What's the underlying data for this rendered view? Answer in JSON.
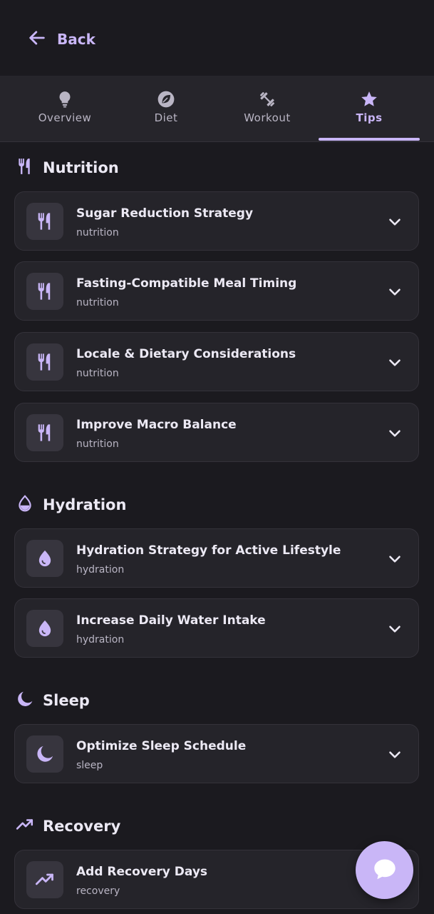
{
  "header": {
    "back_label": "Back",
    "back_icon": "arrow-left-icon"
  },
  "tabs": [
    {
      "label": "Overview",
      "icon": "lightbulb-icon",
      "active": false
    },
    {
      "label": "Diet",
      "icon": "leaf-icon",
      "active": false
    },
    {
      "label": "Workout",
      "icon": "dumbbell-icon",
      "active": false
    },
    {
      "label": "Tips",
      "icon": "star-icon",
      "active": true
    }
  ],
  "sections": {
    "nutrition": {
      "title": "Nutrition",
      "icon": "fork-knife-icon",
      "items": [
        {
          "title": "Sugar Reduction Strategy",
          "category": "nutrition"
        },
        {
          "title": "Fasting-Compatible Meal Timing",
          "category": "nutrition"
        },
        {
          "title": "Locale & Dietary Considerations",
          "category": "nutrition"
        },
        {
          "title": "Improve Macro Balance",
          "category": "nutrition"
        }
      ]
    },
    "hydration": {
      "title": "Hydration",
      "icon": "water-drop-icon",
      "items": [
        {
          "title": "Hydration Strategy for Active Lifestyle",
          "category": "hydration"
        },
        {
          "title": "Increase Daily Water Intake",
          "category": "hydration"
        }
      ]
    },
    "sleep": {
      "title": "Sleep",
      "icon": "moon-icon",
      "items": [
        {
          "title": "Optimize Sleep Schedule",
          "category": "sleep"
        }
      ]
    },
    "recovery": {
      "title": "Recovery",
      "icon": "trending-up-icon",
      "items": [
        {
          "title": "Add Recovery Days",
          "category": "recovery"
        }
      ]
    }
  },
  "fab": {
    "icon": "chat-bubble-icon"
  },
  "colors": {
    "background": "#1b1a1f",
    "card": "#25242a",
    "accent": "#c9b6f7",
    "muted_text": "#b9b5c4"
  }
}
